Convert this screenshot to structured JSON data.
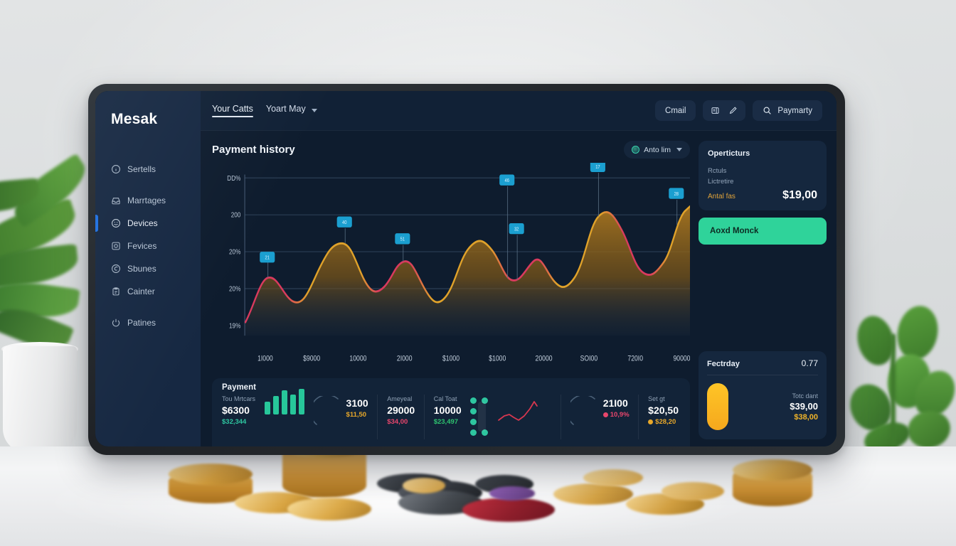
{
  "app": {
    "logo": "Mesak"
  },
  "sidebar": {
    "items": [
      {
        "label": "Sertells",
        "icon": "info-circle-icon",
        "active": false
      },
      {
        "label": "Marrtages",
        "icon": "inbox-icon",
        "active": false
      },
      {
        "label": "Devices",
        "icon": "smiley-icon",
        "active": true
      },
      {
        "label": "Fevices",
        "icon": "face-square-icon",
        "active": false
      },
      {
        "label": "Sbunes",
        "icon": "circle-swirl-icon",
        "active": false
      },
      {
        "label": "Cainter",
        "icon": "clipboard-icon",
        "active": false
      },
      {
        "label": "Patines",
        "icon": "power-icon",
        "active": false
      }
    ]
  },
  "topbar": {
    "tabs": [
      {
        "label": "Your Catts",
        "active": true
      },
      {
        "label": "Yoart May",
        "active": false
      }
    ],
    "chevron_icon": "chevron-down-icon",
    "mail_button": "Cmail",
    "card_icon": "card-icon",
    "edit_icon": "pencil-icon",
    "search_icon": "search-icon",
    "search_label": "Paymarty"
  },
  "main": {
    "section_title": "Payment history",
    "auto_dropdown": {
      "label": "Anto lim",
      "icon": "status-dot-icon",
      "chevron": "chevron-down-icon"
    }
  },
  "chart_data": {
    "type": "area",
    "title": "Payment history",
    "xlabel": "",
    "ylabel": "",
    "grid": true,
    "legend_position": "none",
    "ytick_labels": [
      "DD%",
      "200",
      "20%",
      "20%",
      "19%"
    ],
    "ytick_values": [
      100,
      80,
      60,
      40,
      20
    ],
    "ylim": [
      0,
      110
    ],
    "xtick_labels": [
      "1I000",
      "$9000",
      "10000",
      "2I000",
      "$1000",
      "$1000",
      "20000",
      "SOI00",
      "720I0",
      "90000"
    ],
    "x": [
      0,
      4,
      8,
      12,
      16,
      20,
      24,
      28,
      32,
      36,
      40,
      44,
      48,
      52,
      56,
      60,
      64,
      68,
      72,
      76,
      80,
      84,
      88,
      92,
      96,
      100
    ],
    "values": [
      18,
      30,
      38,
      31,
      24,
      28,
      40,
      52,
      48,
      39,
      36,
      44,
      42,
      33,
      30,
      44,
      58,
      54,
      45,
      40,
      52,
      57,
      48,
      70,
      78,
      62
    ],
    "series": [
      {
        "name": "Payment flow",
        "values": [
          18,
          30,
          38,
          31,
          24,
          28,
          40,
          52,
          48,
          39,
          36,
          44,
          42,
          33,
          30,
          44,
          58,
          54,
          45,
          40,
          52,
          57,
          48,
          70,
          78,
          62
        ]
      }
    ],
    "markers": [
      {
        "x": 8,
        "y": 40,
        "label": "21"
      },
      {
        "x": 25,
        "y": 60,
        "label": "40"
      },
      {
        "x": 33,
        "y": 54,
        "label": "51"
      },
      {
        "x": 62,
        "y": 82,
        "label": "46"
      },
      {
        "x": 63,
        "y": 58,
        "label": "32"
      },
      {
        "x": 74,
        "y": 92,
        "label": "17"
      },
      {
        "x": 93,
        "y": 80,
        "label": "28"
      }
    ],
    "colors": {
      "line_a": "#d93a5e",
      "line_b": "#e0a22a",
      "fill": "#8a6320",
      "marker": "#1b9fd0"
    }
  },
  "stats_strip": {
    "title": "Payment",
    "items": [
      {
        "label": "Tou Mrtcars",
        "value": "$6300",
        "delta": "$32,344",
        "delta_color": "#2ec6a0"
      },
      {
        "label": "",
        "value": "3100",
        "delta": "$11,50",
        "delta_color": "#e8a82a"
      },
      {
        "label": "Ameyeal",
        "value": "29000",
        "delta": "$34,00",
        "delta_color": "#e8466c"
      },
      {
        "label": "Cal Toat",
        "value": "10000",
        "delta": "$23,497",
        "delta_color": "#2ec26f"
      },
      {
        "label": "",
        "value": "21I00",
        "delta": "10,9%",
        "delta_color": "#e8466c"
      },
      {
        "label": "Set gt",
        "value": "$20,50",
        "delta": "$28,20",
        "delta_color": "#e8a82a"
      }
    ],
    "minibar_values": [
      18,
      26,
      34,
      28,
      36
    ]
  },
  "right_panel": {
    "card": {
      "title": "Operticturs",
      "line1": "Rctuls",
      "line2": "Lictretire",
      "amount_label": "Antal fas",
      "amount_value": "$19,00"
    },
    "cta_label": "Aoxd Monck",
    "footer_card": {
      "title": "Fectrday",
      "number": "0.77",
      "total_label": "Totc dant",
      "total_value": "$39,00",
      "total_secondary": "$38,00"
    }
  }
}
